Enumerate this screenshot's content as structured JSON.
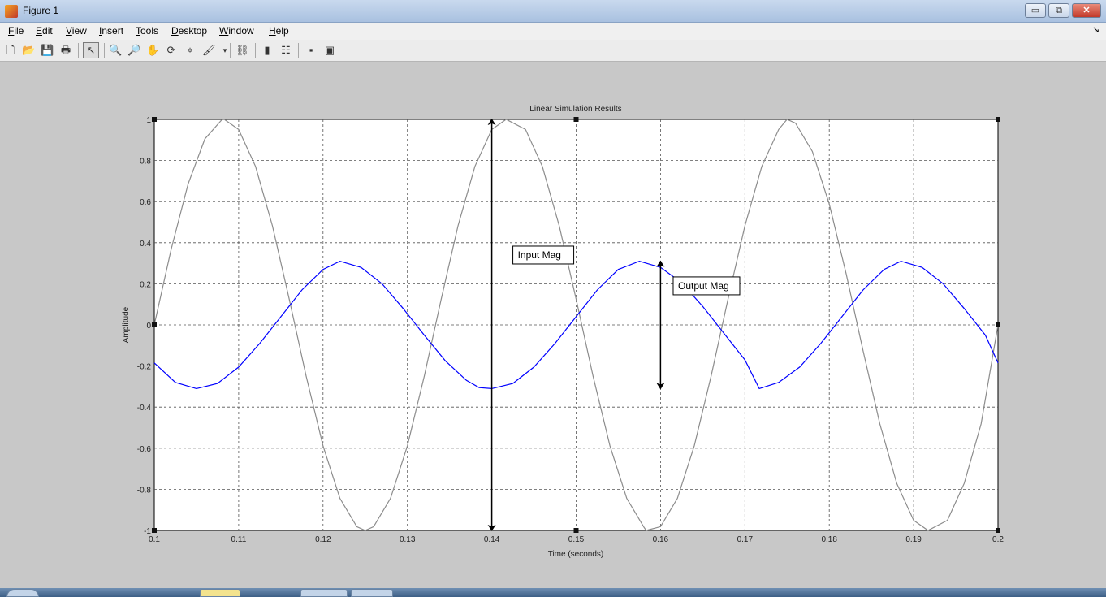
{
  "window": {
    "title": "Figure 1",
    "minimize_icon": "minimize-icon",
    "maximize_icon": "restore-icon",
    "close_icon": "close-icon"
  },
  "menu": {
    "items": [
      "File",
      "Edit",
      "View",
      "Insert",
      "Tools",
      "Desktop",
      "Window",
      "Help"
    ],
    "dock_glyph": "↘"
  },
  "toolbar": {
    "buttons": [
      {
        "name": "new-figure-icon",
        "glyph": "🗋"
      },
      {
        "name": "open-file-icon",
        "glyph": "📂"
      },
      {
        "name": "save-icon",
        "glyph": "💾"
      },
      {
        "name": "print-icon",
        "glyph": "🖶"
      },
      {
        "name": "edit-plot-arrow-icon",
        "glyph": "↖",
        "pressed": true
      },
      {
        "name": "zoom-in-icon",
        "glyph": "🔍"
      },
      {
        "name": "zoom-out-icon",
        "glyph": "🔎"
      },
      {
        "name": "pan-hand-icon",
        "glyph": "✋"
      },
      {
        "name": "rotate-3d-icon",
        "glyph": "⟳"
      },
      {
        "name": "data-cursor-icon",
        "glyph": "⌖"
      },
      {
        "name": "brush-icon",
        "glyph": "🖌"
      },
      {
        "name": "link-plot-icon",
        "glyph": "⛓"
      },
      {
        "name": "colorbar-icon",
        "glyph": "▮"
      },
      {
        "name": "legend-icon",
        "glyph": "☷"
      },
      {
        "name": "hide-plot-tools-icon",
        "glyph": "▪"
      },
      {
        "name": "show-plot-tools-icon",
        "glyph": "▣"
      }
    ]
  },
  "chart_data": {
    "type": "line",
    "title": "Linear Simulation Results",
    "xlabel": "Time (seconds)",
    "ylabel": "Amplitude",
    "xlim": [
      0.1,
      0.2
    ],
    "ylim": [
      -1,
      1
    ],
    "xticks": [
      "0.1",
      "0.11",
      "0.12",
      "0.13",
      "0.14",
      "0.15",
      "0.16",
      "0.17",
      "0.18",
      "0.19",
      "0.2"
    ],
    "yticks": [
      "-1",
      "-0.8",
      "-0.6",
      "-0.4",
      "-0.2",
      "0",
      "0.2",
      "0.4",
      "0.6",
      "0.8",
      "1"
    ],
    "grid": true,
    "series": [
      {
        "color": "#8c8c8c",
        "x": [
          0.1,
          0.102,
          0.104,
          0.106,
          0.108,
          0.1083,
          0.11,
          0.112,
          0.114,
          0.116,
          0.118,
          0.12,
          0.122,
          0.124,
          0.125,
          0.126,
          0.128,
          0.13,
          0.132,
          0.134,
          0.136,
          0.138,
          0.14,
          0.1417,
          0.144,
          0.146,
          0.148,
          0.15,
          0.152,
          0.154,
          0.156,
          0.158,
          0.1583,
          0.16,
          0.162,
          0.164,
          0.166,
          0.168,
          0.17,
          0.172,
          0.174,
          0.175,
          0.176,
          0.178,
          0.18,
          0.182,
          0.184,
          0.186,
          0.188,
          0.19,
          0.1917,
          0.194,
          0.196,
          0.198,
          0.2
        ],
        "y": [
          0.0,
          0.368,
          0.685,
          0.905,
          0.998,
          1.0,
          0.951,
          0.771,
          0.482,
          0.125,
          -0.249,
          -0.588,
          -0.844,
          -0.982,
          -1.0,
          -0.982,
          -0.844,
          -0.588,
          -0.249,
          0.125,
          0.482,
          0.771,
          0.951,
          1.0,
          0.951,
          0.771,
          0.482,
          0.125,
          -0.249,
          -0.588,
          -0.844,
          -0.982,
          -1.0,
          -0.982,
          -0.844,
          -0.588,
          -0.249,
          0.125,
          0.482,
          0.771,
          0.951,
          1.0,
          0.982,
          0.844,
          0.588,
          0.249,
          -0.125,
          -0.482,
          -0.771,
          -0.951,
          -1.0,
          -0.951,
          -0.771,
          -0.482,
          0.0
        ]
      },
      {
        "color": "#0000ff",
        "x": [
          0.1,
          0.1025,
          0.105,
          0.1075,
          0.11,
          0.1125,
          0.115,
          0.1175,
          0.12,
          0.122,
          0.1245,
          0.127,
          0.1295,
          0.132,
          0.1345,
          0.137,
          0.1385,
          0.14,
          0.1425,
          0.145,
          0.1475,
          0.15,
          0.1525,
          0.155,
          0.1575,
          0.16,
          0.1625,
          0.165,
          0.1675,
          0.17,
          0.1717,
          0.174,
          0.1765,
          0.179,
          0.1815,
          0.184,
          0.1865,
          0.1885,
          0.191,
          0.1935,
          0.196,
          0.1985,
          0.2
        ],
        "y": [
          -0.185,
          -0.28,
          -0.31,
          -0.285,
          -0.205,
          -0.09,
          0.04,
          0.17,
          0.27,
          0.31,
          0.28,
          0.2,
          0.08,
          -0.05,
          -0.175,
          -0.27,
          -0.305,
          -0.31,
          -0.285,
          -0.205,
          -0.09,
          0.04,
          0.17,
          0.27,
          0.31,
          0.28,
          0.205,
          0.09,
          -0.04,
          -0.17,
          -0.31,
          -0.28,
          -0.205,
          -0.09,
          0.04,
          0.17,
          0.27,
          0.31,
          0.28,
          0.2,
          0.08,
          -0.05,
          -0.185
        ]
      }
    ],
    "annotations": [
      {
        "text": "Input Mag",
        "arrow_x": 0.14,
        "arrow_y": [
          -1,
          1
        ],
        "label_x": 0.1425,
        "label_y": 0.34
      },
      {
        "text": "Output Mag",
        "arrow_x": 0.16,
        "arrow_y": [
          -0.31,
          0.31
        ],
        "label_x": 0.1615,
        "label_y": 0.19
      }
    ]
  },
  "colors": {
    "axes_bg": "#ffffff",
    "figure_bg": "#c8c8c8",
    "grid": "#333333"
  }
}
